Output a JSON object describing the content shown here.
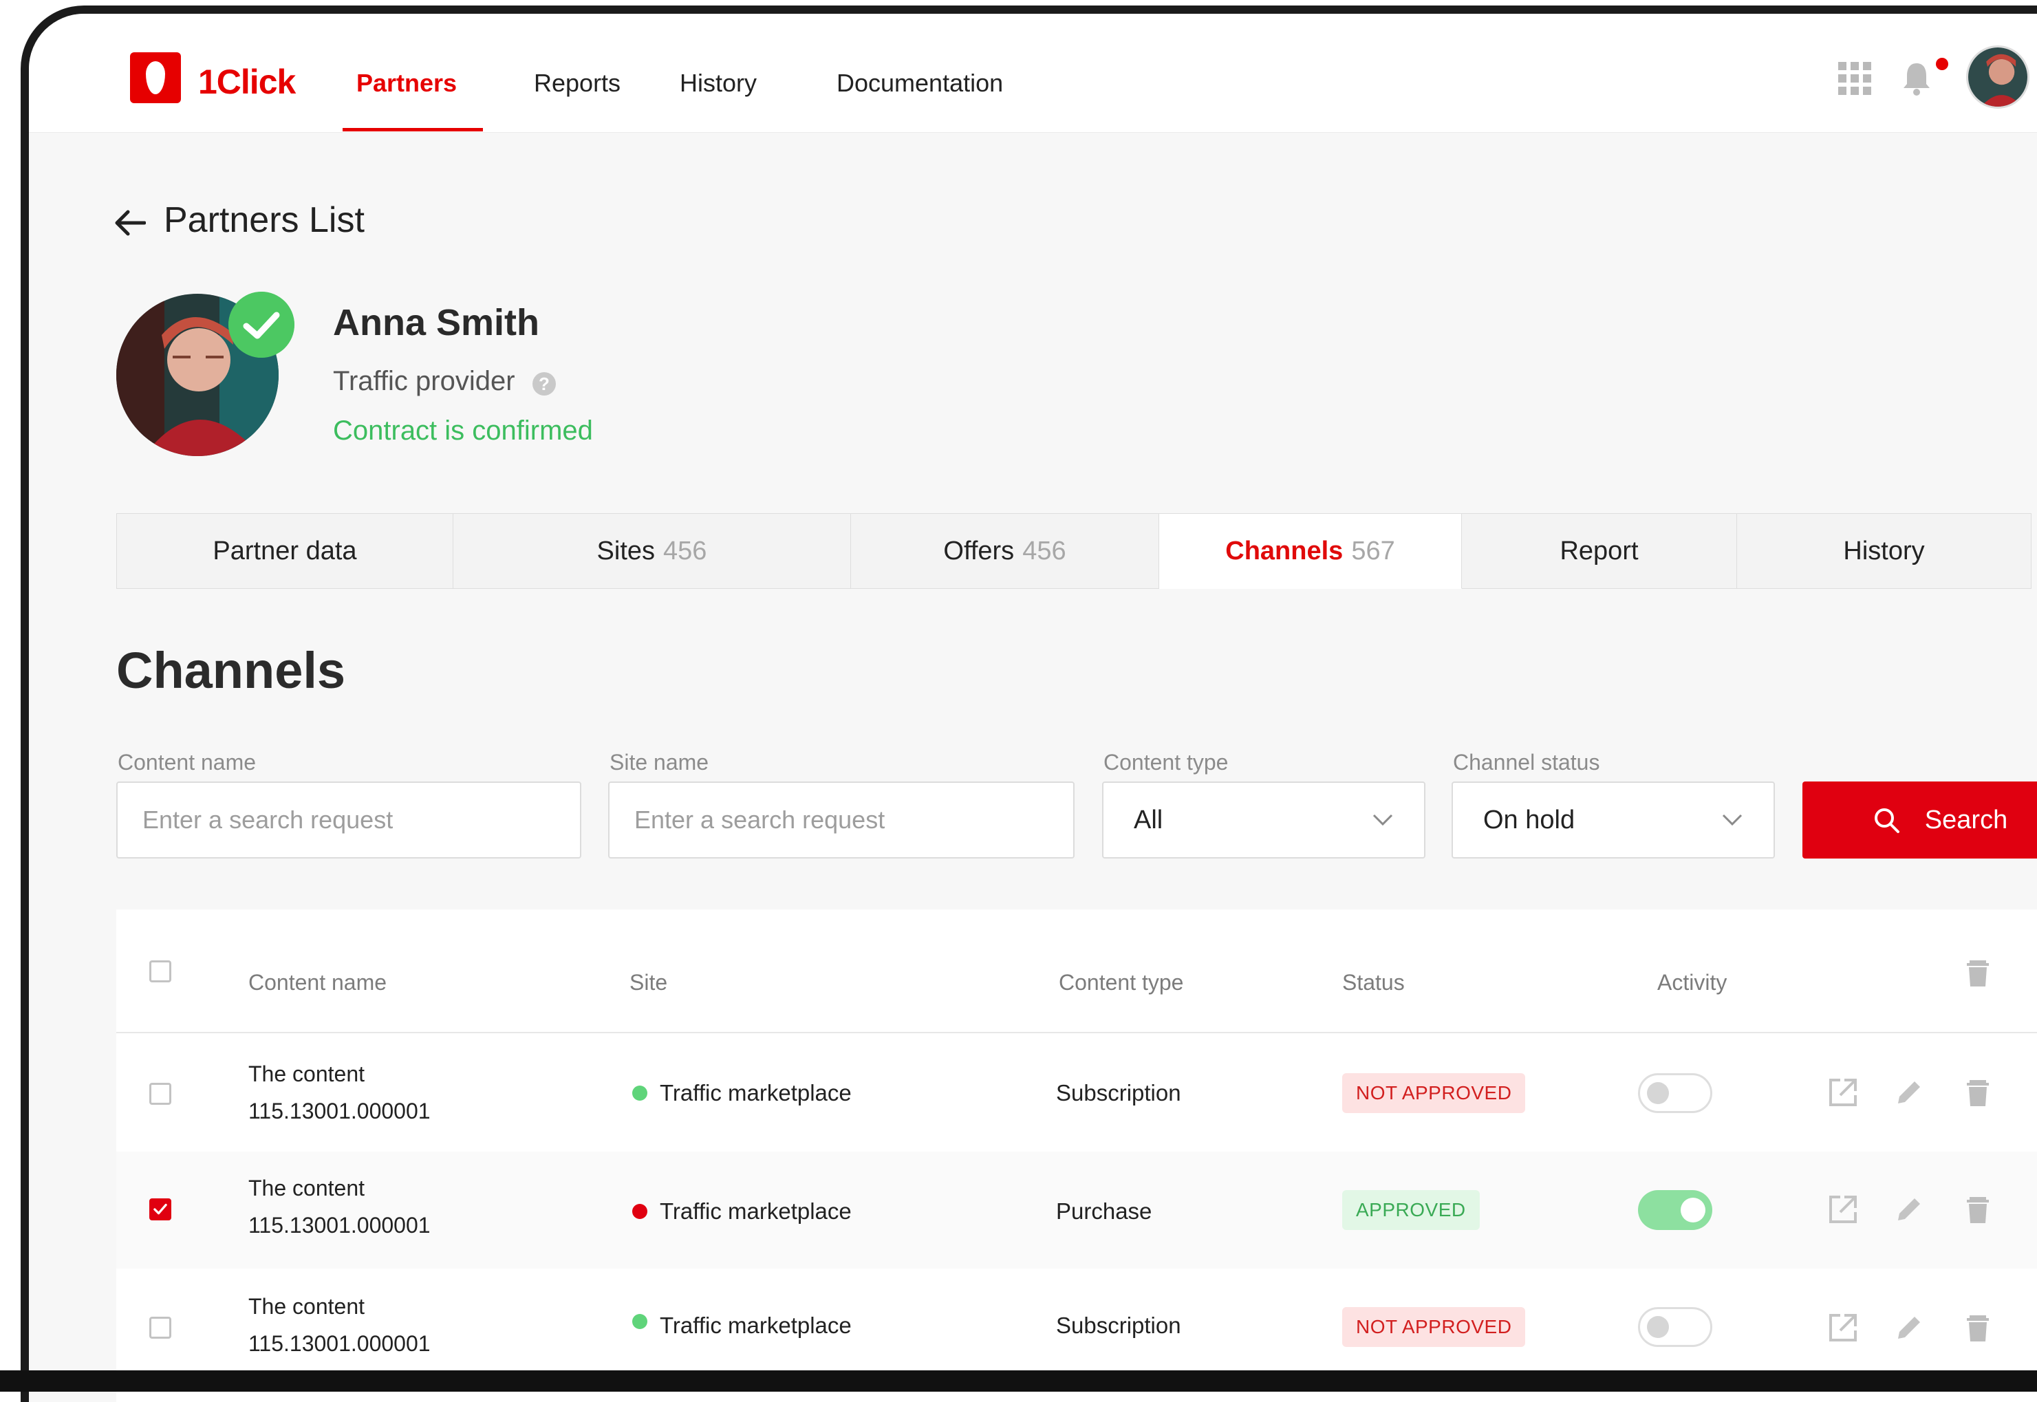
{
  "app": {
    "brand": "1Click",
    "nav": [
      {
        "label": "Partners",
        "active": true
      },
      {
        "label": "Reports"
      },
      {
        "label": "History"
      },
      {
        "label": "Documentation"
      }
    ],
    "accent_color": "#e60000"
  },
  "page": {
    "back_title": "Partners List"
  },
  "partner": {
    "name": "Anna Smith",
    "role": "Traffic provider",
    "help_glyph": "?",
    "contract_status": "Contract is confirmed",
    "status_color": "#3cbd5e"
  },
  "tabs": [
    {
      "label": "Partner data",
      "count": ""
    },
    {
      "label": "Sites",
      "count": "456"
    },
    {
      "label": "Offers",
      "count": "456"
    },
    {
      "label": "Channels",
      "count": "567",
      "active": true
    },
    {
      "label": "Report",
      "count": ""
    },
    {
      "label": "History",
      "count": ""
    }
  ],
  "section": {
    "title": "Channels"
  },
  "filters": {
    "content_name": {
      "label": "Content name",
      "placeholder": "Enter a search request"
    },
    "site_name": {
      "label": "Site name",
      "placeholder": "Enter a search request"
    },
    "content_type": {
      "label": "Content type",
      "value": "All"
    },
    "channel_status": {
      "label": "Channel status",
      "value": "On hold"
    },
    "search_label": "Search"
  },
  "table": {
    "columns": [
      "Content name",
      "Site",
      "Content type",
      "Status",
      "Activity"
    ],
    "rows": [
      {
        "name_line1": "The content",
        "name_line2": "115.13001.000001",
        "site": "Traffic marketplace",
        "site_dot": "#5fd47a",
        "content_type": "Subscription",
        "status": "NOT APPROVED",
        "active": false,
        "checked": false
      },
      {
        "name_line1": "The content",
        "name_line2": "115.13001.000001",
        "site": "Traffic marketplace",
        "site_dot": "#e00010",
        "content_type": "Purchase",
        "status": "APPROVED",
        "active": true,
        "checked": true
      },
      {
        "name_line1": "The content",
        "name_line2": "115.13001.000001",
        "site": "Traffic marketplace",
        "site_dot": "#5fd47a",
        "content_type": "Subscription",
        "status": "NOT APPROVED",
        "active": false,
        "checked": false
      }
    ]
  }
}
